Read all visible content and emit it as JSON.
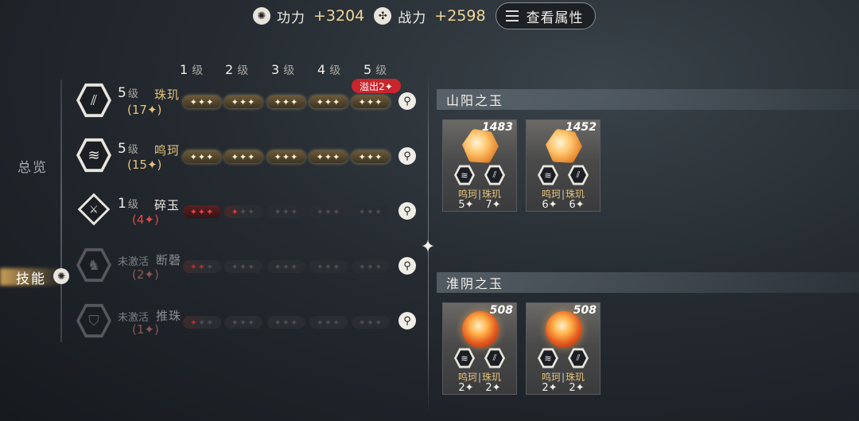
{
  "top": {
    "gongli_label": "功力",
    "gongli_value": "+3204",
    "zhanli_label": "战力",
    "zhanli_value": "+2598",
    "attr_button": "查看属性"
  },
  "nav": {
    "overview": "总览",
    "skill": "技能"
  },
  "levels": [
    "1",
    "2",
    "3",
    "4",
    "5"
  ],
  "level_suffix": "级",
  "overflow_badge": "溢出2✦",
  "skills": [
    {
      "level": "5",
      "level_suffix": "级",
      "name": "珠玑",
      "count": "(17✦)",
      "pips": [
        "gold",
        "gold",
        "gold",
        "gold",
        "gold"
      ]
    },
    {
      "level": "5",
      "level_suffix": "级",
      "name": "鸣珂",
      "count": "(15✦)",
      "pips": [
        "gold",
        "gold",
        "gold",
        "gold",
        "gold"
      ]
    },
    {
      "level": "1",
      "level_suffix": "级",
      "name": "碎玉",
      "count": "(4✦)",
      "pips": [
        "red",
        "half",
        "empty",
        "empty",
        "empty"
      ]
    },
    {
      "status": "未激活",
      "name": "断磬",
      "count": "(2✦)",
      "pips": [
        "halfdim",
        "empty",
        "empty",
        "empty",
        "empty"
      ]
    },
    {
      "status": "未激活",
      "name": "推珠",
      "count": "(1✦)",
      "pips": [
        "onedim",
        "empty",
        "empty",
        "empty",
        "empty"
      ]
    }
  ],
  "sections": [
    {
      "title": "山阳之玉",
      "cards": [
        {
          "power": "1483",
          "gem": "crystal",
          "skill_a": "鸣珂",
          "skill_b": "珠玑",
          "val_a": "5✦",
          "val_b": "7✦"
        },
        {
          "power": "1452",
          "gem": "crystal",
          "skill_a": "鸣珂",
          "skill_b": "珠玑",
          "val_a": "6✦",
          "val_b": "6✦"
        }
      ]
    },
    {
      "title": "淮阴之玉",
      "cards": [
        {
          "power": "508",
          "gem": "orb",
          "skill_a": "鸣珂",
          "skill_b": "珠玑",
          "val_a": "2✦",
          "val_b": "2✦"
        },
        {
          "power": "508",
          "gem": "orb",
          "skill_a": "鸣珂",
          "skill_b": "珠玑",
          "val_a": "2✦",
          "val_b": "2✦"
        }
      ]
    }
  ],
  "colors": {
    "gold": "#e6c27a",
    "red": "#e04848",
    "badge_red": "#c8262c"
  }
}
